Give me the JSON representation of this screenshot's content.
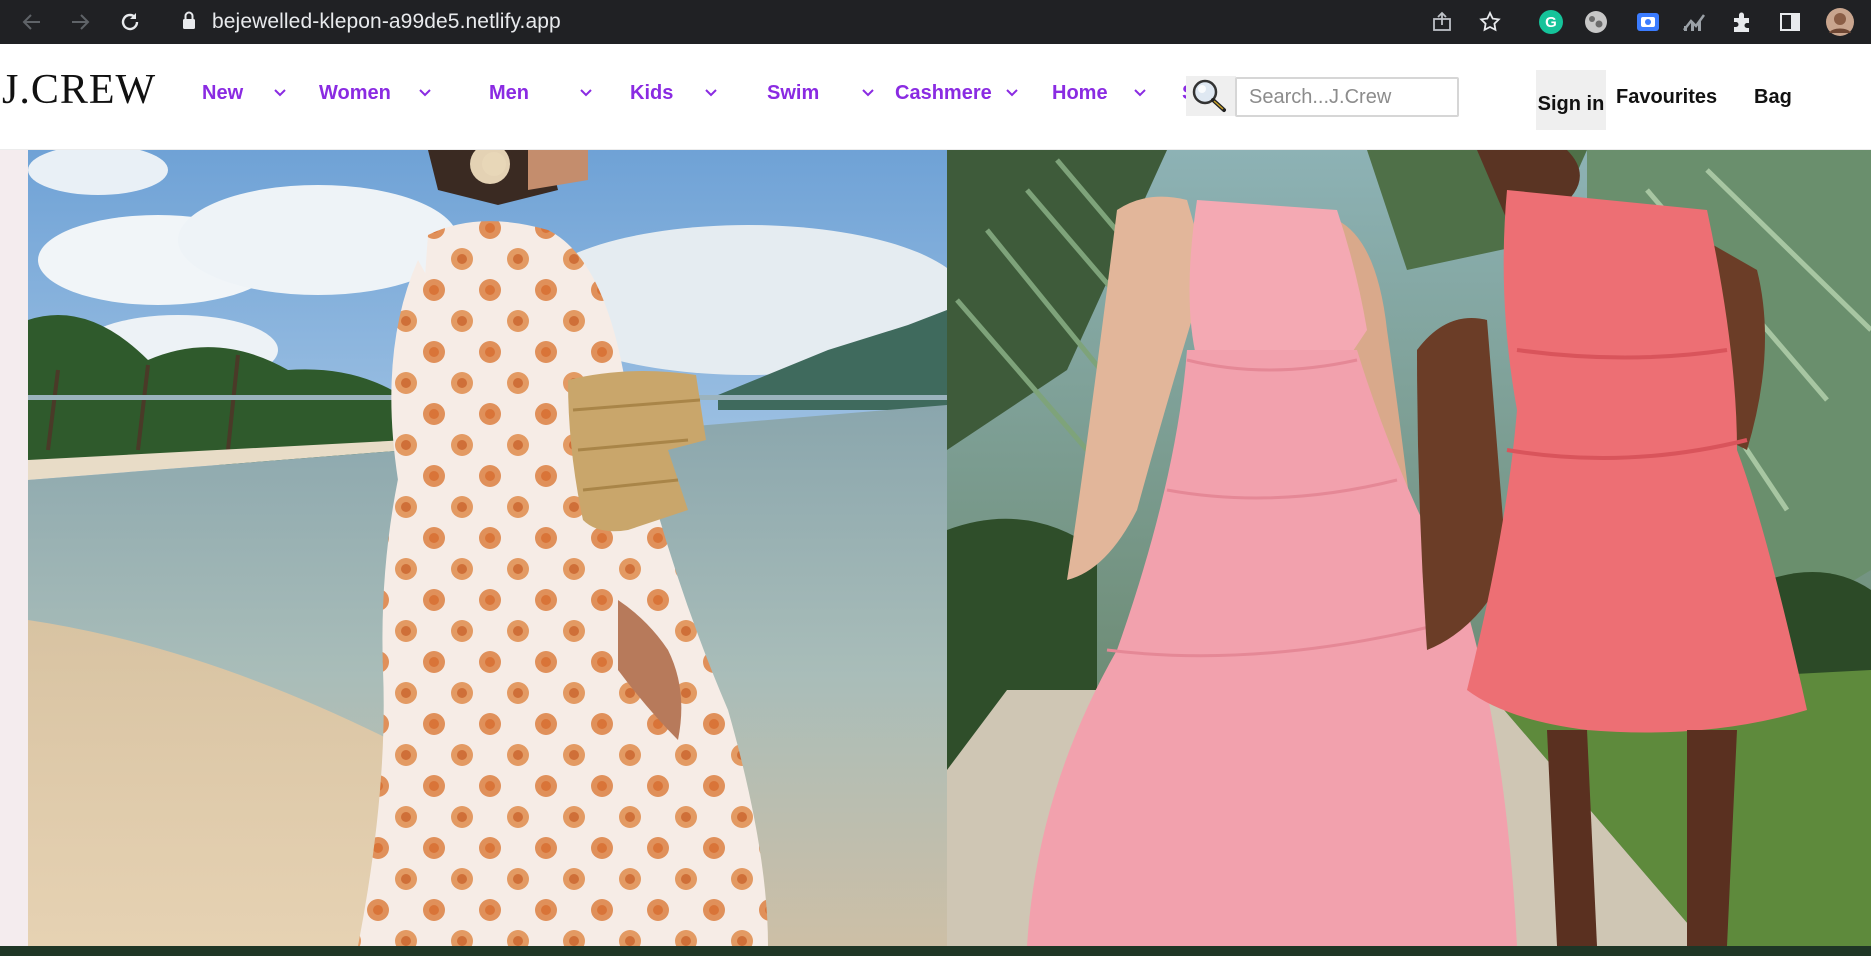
{
  "browser": {
    "url": "bejewelled-klepon-a99de5.netlify.app",
    "toolbar_icons": [
      "back-icon",
      "forward-icon",
      "reload-icon",
      "lock-icon",
      "share-icon",
      "star-icon",
      "grammarly-icon",
      "extension-icon",
      "screen-capture-icon",
      "stats-icon",
      "puzzle-icon",
      "sidepanel-icon",
      "profile-avatar"
    ]
  },
  "site": {
    "logo": "J.CREW",
    "nav": [
      {
        "label": "New"
      },
      {
        "label": "Women"
      },
      {
        "label": "Men"
      },
      {
        "label": "Kids"
      },
      {
        "label": "Swim"
      },
      {
        "label": "Cashmere"
      },
      {
        "label": "Home"
      }
    ],
    "nav_overflow_char": "S",
    "search": {
      "placeholder": "Search...J.Crew",
      "value": ""
    },
    "signin_label": "Sign in",
    "favourites_label": "Favourites",
    "bag_label": "Bag"
  },
  "colors": {
    "nav_accent": "#8a2be2",
    "chrome_bg": "#202124"
  },
  "hero": {
    "images": [
      "beach-floral-dress-photo",
      "pink-sundresses-photo"
    ]
  }
}
